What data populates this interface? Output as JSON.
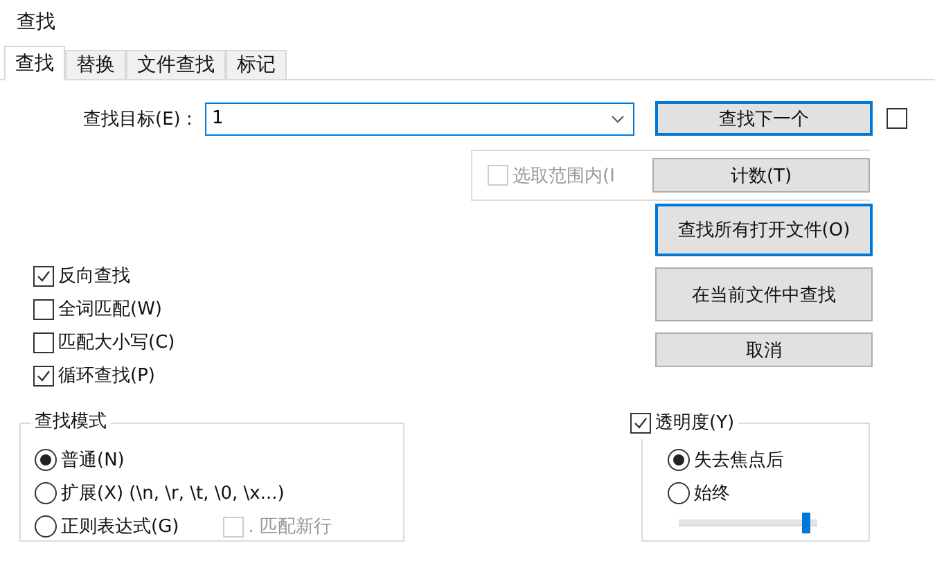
{
  "window": {
    "title": "查找"
  },
  "tabs": [
    {
      "label": "查找",
      "selected": true
    },
    {
      "label": "替换",
      "selected": false
    },
    {
      "label": "文件查找",
      "selected": false
    },
    {
      "label": "标记",
      "selected": false
    }
  ],
  "find_field": {
    "label": "查找目标(E) :",
    "value": "1"
  },
  "side_checkbox": {
    "checked": false
  },
  "in_selection": {
    "label": "选取范围内(I",
    "checked": false,
    "disabled": true
  },
  "buttons": [
    {
      "label": "查找下一个",
      "default": true
    },
    {
      "label": "计数(T)",
      "default": false
    },
    {
      "label": "查找所有打开文件(O)",
      "default": true
    },
    {
      "label": "在当前文件中查找",
      "default": false
    },
    {
      "label": "取消",
      "default": false
    }
  ],
  "options": [
    {
      "label": "反向查找",
      "checked": true
    },
    {
      "label": "全词匹配(W)",
      "checked": false
    },
    {
      "label": "匹配大小写(C)",
      "checked": false
    },
    {
      "label": "循环查找(P)",
      "checked": true
    }
  ],
  "search_mode": {
    "title": "查找模式",
    "options": [
      {
        "label": "普通(N)",
        "selected": true
      },
      {
        "label": "扩展(X) (\\n, \\r, \\t, \\0, \\x...)",
        "selected": false
      },
      {
        "label": "正则表达式(G)",
        "selected": false
      }
    ],
    "dot_newline": {
      "label": ". 匹配新行",
      "checked": false,
      "disabled": true
    }
  },
  "transparency": {
    "label": "透明度(Y)",
    "checked": true,
    "options": [
      {
        "label": "失去焦点后",
        "selected": true
      },
      {
        "label": "始终",
        "selected": false
      }
    ],
    "level": 0.95
  }
}
